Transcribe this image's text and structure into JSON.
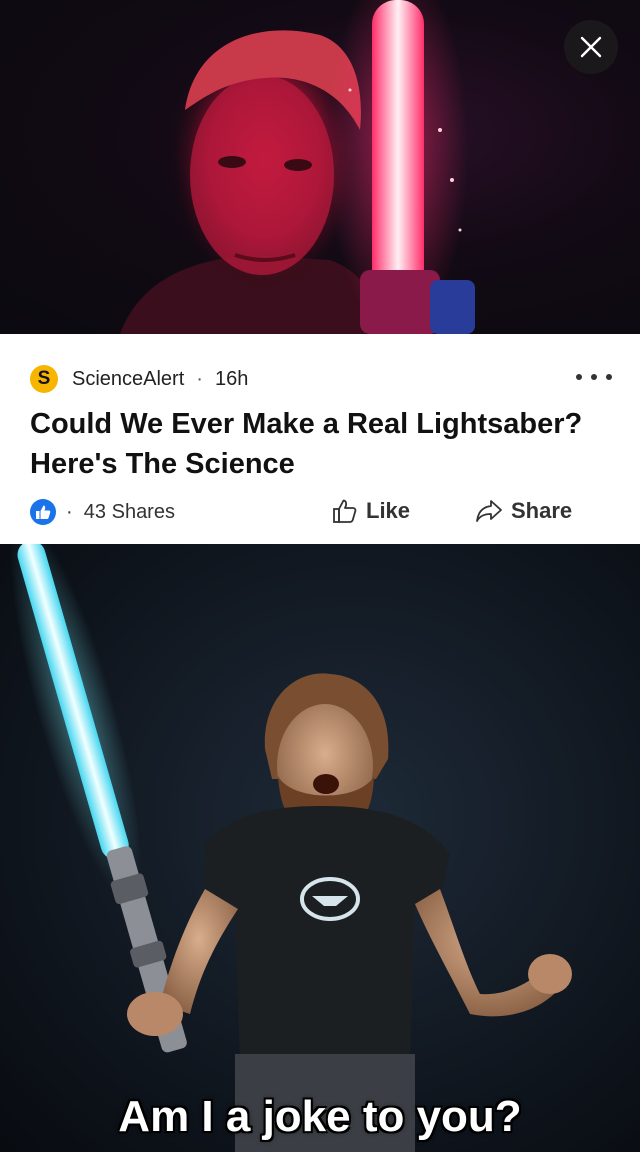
{
  "post": {
    "source_name": "ScienceAlert",
    "source_logo_letter": "S",
    "separator": "·",
    "time_ago": "16h",
    "headline": "Could We Ever Make a Real Lightsaber? Here's The Science",
    "shares": "43 Shares",
    "like_label": "Like",
    "share_label": "Share"
  },
  "meme": {
    "caption": "Am I a joke to you?"
  },
  "colors": {
    "brand_logo": "#f7b500",
    "like_badge": "#1a73e8",
    "saber_red": "#ff2d6a",
    "saber_blue": "#7ff5ff"
  },
  "icons": [
    "close-icon",
    "more-icon",
    "thumbs-up-icon",
    "share-arrow-icon"
  ]
}
